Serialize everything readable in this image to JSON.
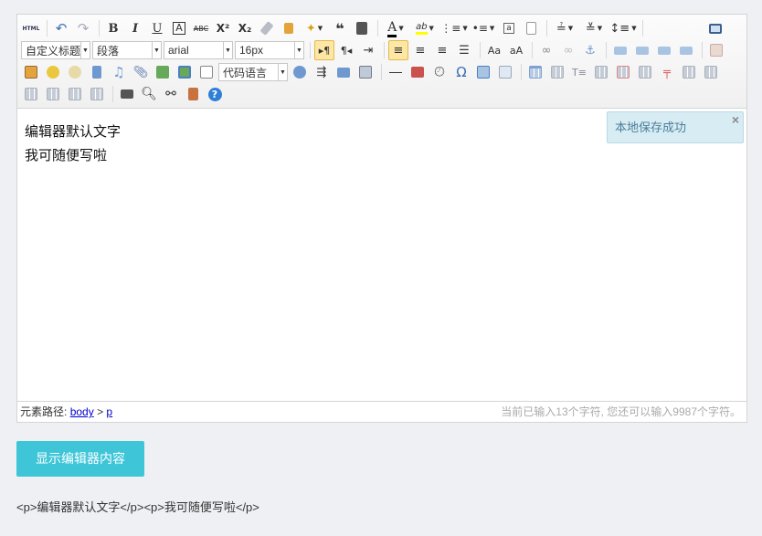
{
  "toolbar": {
    "html_label": "HTML",
    "bold": "B",
    "italic": "I",
    "underline": "U",
    "fontborder": "A",
    "strikethrough": "ABC",
    "superscript": "X²",
    "subscript": "X₂",
    "blockquote": "❝",
    "forecolor": "A",
    "backcolor": "ab",
    "customstyle_value": "自定义标题",
    "paragraph_value": "段落",
    "fontfamily_value": "arial",
    "fontsize_value": "16px",
    "codelanguage_value": "代码语言",
    "special_char": "Ω",
    "help": "?"
  },
  "content": {
    "lines": [
      "编辑器默认文字",
      "我可随便写啦"
    ]
  },
  "toast": {
    "message": "本地保存成功",
    "close": "×"
  },
  "statusbar": {
    "path_label": "元素路径:",
    "path_body": "body",
    "path_sep": ">",
    "path_p": "p",
    "word_count": "当前已输入13个字符, 您还可以输入9987个字符。"
  },
  "actions": {
    "show_content_label": "显示编辑器内容"
  },
  "output": {
    "html": "<p>编辑器默认文字</p><p>我可随便写啦</p>"
  },
  "colors": {
    "accent": "#3ec6d8",
    "toast_bg": "#d8ecf4",
    "toast_text": "#4a7f99",
    "active_btn": "#fde7a4"
  }
}
